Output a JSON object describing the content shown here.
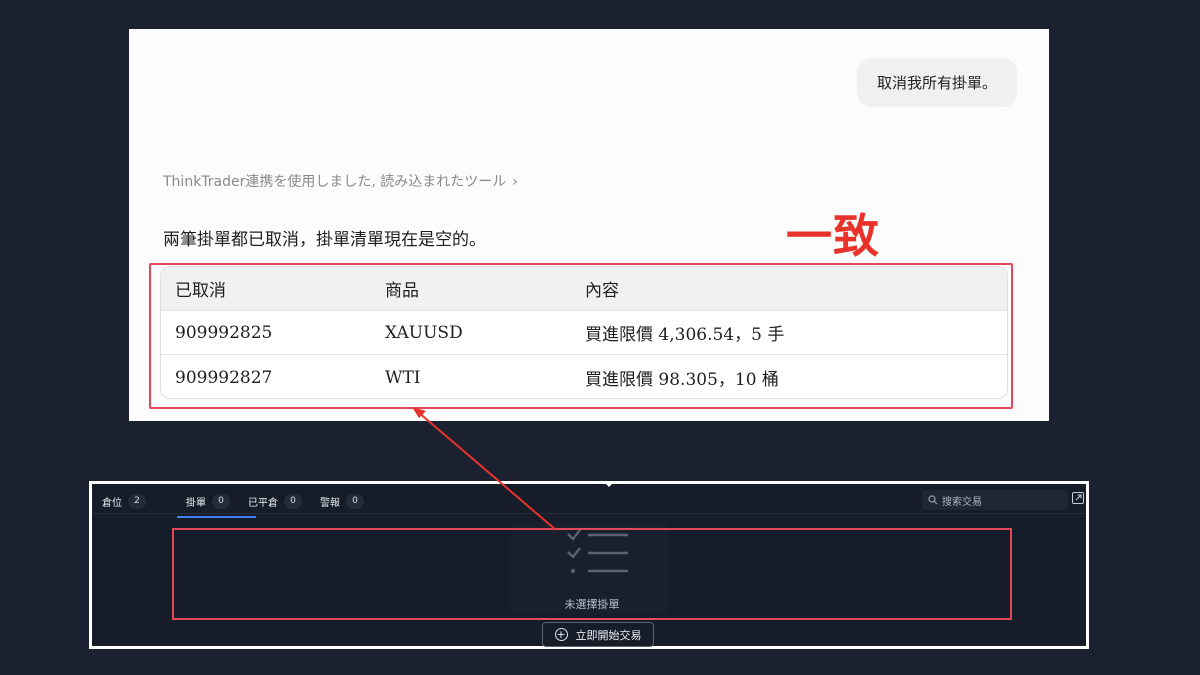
{
  "chat": {
    "user_message": "取消我所有掛單。",
    "tool_note": "ThinkTrader連携を使用しました, 読み込まれたツール",
    "tool_chevron": "›",
    "answer": "兩筆掛單都已取消，掛單清單現在是空的。",
    "table": {
      "headers": [
        "已取消",
        "商品",
        "內容"
      ],
      "rows": [
        [
          "909992825",
          "XAUUSD",
          "買進限價 4,306.54，5 手"
        ],
        [
          "909992827",
          "WTI",
          "買進限價 98.305，10 桶"
        ]
      ]
    }
  },
  "annotation": {
    "match_label": "一致",
    "accent_color": "#e3485c",
    "arrow_color": "#e8332b"
  },
  "trading": {
    "tabs": [
      {
        "label": "倉位",
        "count": "2"
      },
      {
        "label": "掛單",
        "count": "0"
      },
      {
        "label": "已平倉",
        "count": "0"
      },
      {
        "label": "警報",
        "count": "0"
      }
    ],
    "active_tab": "掛單",
    "search_placeholder": "搜索交易",
    "empty_text": "未選擇掛單",
    "start_button": "立即開始交易",
    "accent_color": "#3b82f6"
  }
}
